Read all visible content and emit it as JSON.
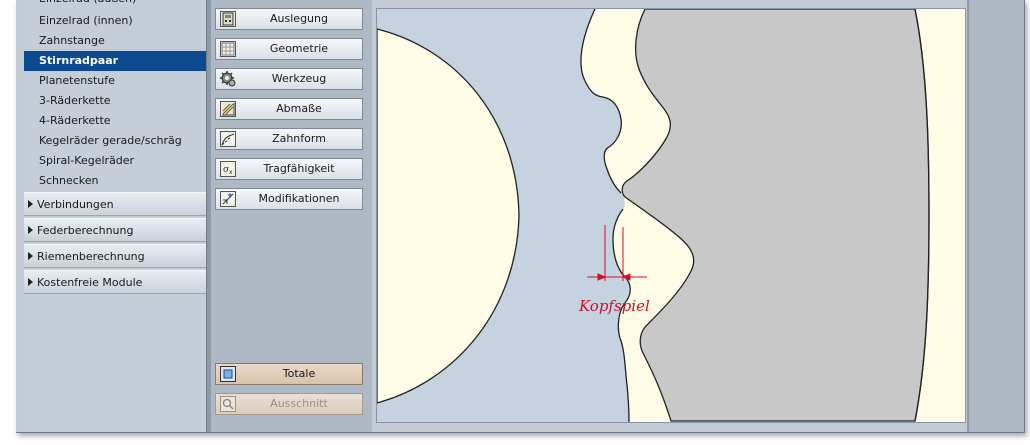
{
  "nav": {
    "sub_items": [
      {
        "label": "Einzelrad (außen)",
        "selected": false
      },
      {
        "label": "Einzelrad (innen)",
        "selected": false
      },
      {
        "label": "Zahnstange",
        "selected": false
      },
      {
        "label": "Stirnradpaar",
        "selected": true
      },
      {
        "label": "Planetenstufe",
        "selected": false
      },
      {
        "label": "3-Räderkette",
        "selected": false
      },
      {
        "label": "4-Räderkette",
        "selected": false
      },
      {
        "label": "Kegelräder gerade/schräg",
        "selected": false
      },
      {
        "label": "Spiral-Kegelräder",
        "selected": false
      },
      {
        "label": "Schnecken",
        "selected": false
      }
    ],
    "groups": [
      {
        "label": "Verbindungen"
      },
      {
        "label": "Federberechnung"
      },
      {
        "label": "Riemenberechnung"
      },
      {
        "label": "Kostenfreie Module"
      }
    ]
  },
  "toolbar": {
    "buttons": [
      {
        "label": "Auslegung",
        "icon": "calculator-icon"
      },
      {
        "label": "Geometrie",
        "icon": "grid-icon"
      },
      {
        "label": "Werkzeug",
        "icon": "gear-tool-icon"
      },
      {
        "label": "Abmaße",
        "icon": "dimension-icon"
      },
      {
        "label": "Zahnform",
        "icon": "tooth-form-icon"
      },
      {
        "label": "Tragfähigkeit",
        "icon": "load-capacity-icon"
      },
      {
        "label": "Modifikationen",
        "icon": "modification-icon"
      }
    ],
    "totale_label": "Totale",
    "ausschnitt_label": "Ausschnitt"
  },
  "drawing": {
    "annotation": "Kopfspiel",
    "colors": {
      "background": "#c5d2e0",
      "tooth_fill": "#fffde8",
      "gear_fill": "#c8c8c8",
      "annotation": "#d0102a",
      "nav_selected": "#0d4a8f"
    }
  }
}
